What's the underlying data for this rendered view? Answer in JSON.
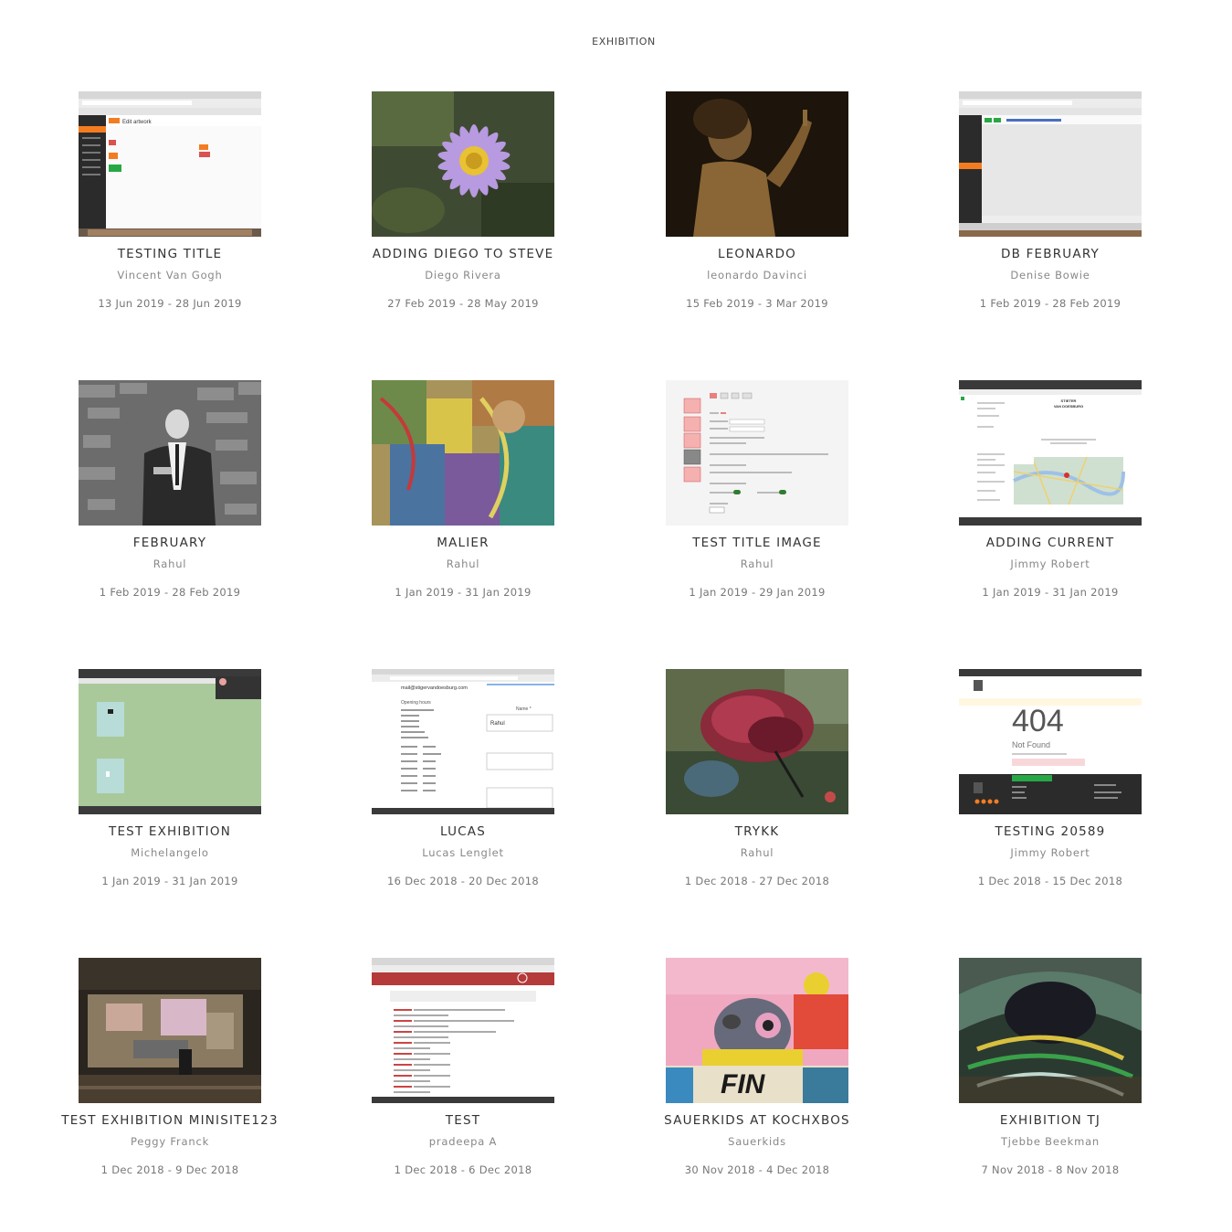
{
  "page": {
    "title": "EXHIBITION"
  },
  "exhibitions": [
    {
      "title": "TESTING TITLE",
      "artist": "Vincent Van Gogh",
      "dates": "13 Jun 2019 - 28 Jun 2019",
      "thumb_kind": "admin-screenshot"
    },
    {
      "title": "ADDING DIEGO TO STEVE",
      "artist": "Diego Rivera",
      "dates": "27 Feb 2019 - 28 May 2019",
      "thumb_kind": "purple-flower-photo"
    },
    {
      "title": "LEONARDO",
      "artist": "leonardo Davinci",
      "dates": "15 Feb 2019 - 3 Mar 2019",
      "thumb_kind": "renaissance-painting"
    },
    {
      "title": "DB FEBRUARY",
      "artist": "Denise Bowie",
      "dates": "1 Feb 2019 - 28 Feb 2019",
      "thumb_kind": "admin-screenshot-blank"
    },
    {
      "title": "FEBRUARY",
      "artist": "Rahul",
      "dates": "1 Feb 2019 - 28 Feb 2019",
      "thumb_kind": "bw-portrait-photo"
    },
    {
      "title": "MALIER",
      "artist": "Rahul",
      "dates": "1 Jan 2019 - 31 Jan 2019",
      "thumb_kind": "abstract-painting"
    },
    {
      "title": "TEST TITLE IMAGE",
      "artist": "Rahul",
      "dates": "1 Jan 2019 - 29 Jan 2019",
      "thumb_kind": "form-screenshot"
    },
    {
      "title": "ADDING CURRENT",
      "artist": "Jimmy Robert",
      "dates": "1 Jan 2019 - 31 Jan 2019",
      "thumb_kind": "map-screenshot"
    },
    {
      "title": "TEST EXHIBITION",
      "artist": "Michelangelo",
      "dates": "1 Jan 2019 - 31 Jan 2019",
      "thumb_kind": "green-site-screenshot"
    },
    {
      "title": "LUCAS",
      "artist": "Lucas Lenglet",
      "dates": "16 Dec 2018 - 20 Dec 2018",
      "thumb_kind": "contact-form-screenshot"
    },
    {
      "title": "TRYKK",
      "artist": "Rahul",
      "dates": "1 Dec 2018 - 27 Dec 2018",
      "thumb_kind": "red-watercolor-painting"
    },
    {
      "title": "TESTING 20589",
      "artist": "Jimmy Robert",
      "dates": "1 Dec 2018 - 15 Dec 2018",
      "thumb_kind": "404-screenshot"
    },
    {
      "title": "TEST EXHIBITION MINISITE123",
      "artist": "Peggy Franck",
      "dates": "1 Dec 2018 - 9 Dec 2018",
      "thumb_kind": "installation-photo"
    },
    {
      "title": "TEST",
      "artist": "pradeepa A",
      "dates": "1 Dec 2018 - 6 Dec 2018",
      "thumb_kind": "error-page-screenshot"
    },
    {
      "title": "SAUERKIDS AT KOCHXBOS",
      "artist": "Sauerkids",
      "dates": "30 Nov 2018 - 4 Dec 2018",
      "thumb_kind": "pop-art-painting"
    },
    {
      "title": "EXHIBITION TJ",
      "artist": "Tjebbe Beekman",
      "dates": "7 Nov 2018 - 8 Nov 2018",
      "thumb_kind": "dark-abstract-painting"
    }
  ],
  "thumb_texts": {
    "edit_artwork": "Edit artwork",
    "not_found_code": "404",
    "not_found_text": "Not Found",
    "lucas_name_label": "Name *",
    "lucas_name_value": "Rahul",
    "lucas_opening_hours": "Opening hours",
    "sauer_fin": "FIN",
    "stieter": "STIETER",
    "van_doesburg": "VAN DOESBURG"
  },
  "colors": {
    "text_title": "#333333",
    "text_meta": "#888888",
    "admin_orange": "#f47c20",
    "admin_dark": "#2b2b2b",
    "green_site": "#a9c99a",
    "error_red": "#b53a3a"
  }
}
